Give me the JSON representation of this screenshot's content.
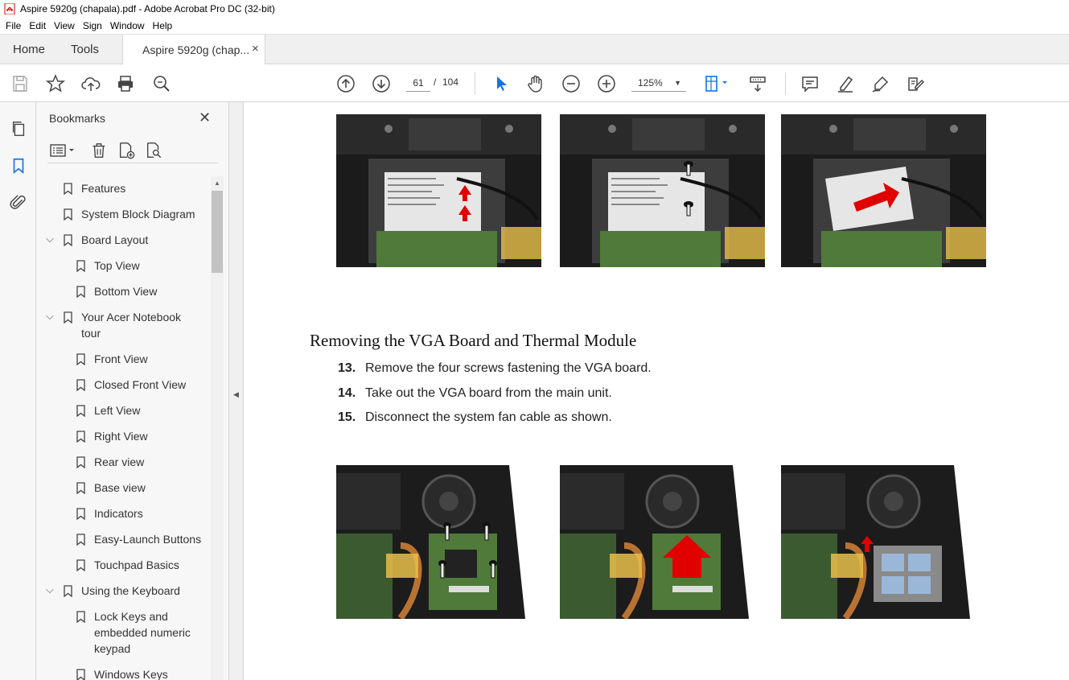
{
  "window": {
    "title": "Aspire 5920g (chapala).pdf - Adobe Acrobat Pro DC (32-bit)"
  },
  "menu": [
    "File",
    "Edit",
    "View",
    "Sign",
    "Window",
    "Help"
  ],
  "tabs": {
    "home": "Home",
    "tools": "Tools",
    "document": "Aspire 5920g (chap...",
    "close_glyph": "×"
  },
  "toolbar": {
    "page_current": "61",
    "page_separator": "/",
    "page_total": "104",
    "zoom": "125%",
    "icons": [
      "save-icon",
      "bookmark-star-icon",
      "upload-icon",
      "print-icon",
      "find-icon",
      "previous-page-icon",
      "next-page-icon",
      "select-arrow-icon",
      "hand-icon",
      "zoom-out-icon",
      "zoom-in-icon",
      "page-display-icon",
      "scrolling-mode-icon",
      "comment-icon",
      "highlight-icon",
      "sign-icon",
      "fill-sign-icon"
    ]
  },
  "left_rail": {
    "icons": [
      "pages-thumbnails-icon",
      "bookmarks-icon",
      "attachments-icon"
    ]
  },
  "bookmarks": {
    "header": "Bookmarks",
    "close_glyph": "✕",
    "items": [
      {
        "label": "Features",
        "level": 0,
        "expanded": null
      },
      {
        "label": "System Block Diagram",
        "level": 0,
        "expanded": null
      },
      {
        "label": "Board Layout",
        "level": 0,
        "expanded": true
      },
      {
        "label": "Top View",
        "level": 1,
        "expanded": null
      },
      {
        "label": "Bottom View",
        "level": 1,
        "expanded": null
      },
      {
        "label": "Your Acer Notebook tour",
        "level": 0,
        "expanded": true
      },
      {
        "label": "Front View",
        "level": 1,
        "expanded": null
      },
      {
        "label": "Closed Front View",
        "level": 1,
        "expanded": null
      },
      {
        "label": "Left View",
        "level": 1,
        "expanded": null
      },
      {
        "label": "Right View",
        "level": 1,
        "expanded": null
      },
      {
        "label": "Rear view",
        "level": 1,
        "expanded": null
      },
      {
        "label": "Base view",
        "level": 1,
        "expanded": null
      },
      {
        "label": "Indicators",
        "level": 1,
        "expanded": null
      },
      {
        "label": "Easy-Launch Buttons",
        "level": 1,
        "expanded": null
      },
      {
        "label": "Touchpad Basics",
        "level": 1,
        "expanded": null
      },
      {
        "label": "Using the Keyboard",
        "level": 0,
        "expanded": true
      },
      {
        "label": "Lock Keys and embedded numeric keypad",
        "level": 1,
        "expanded": null
      },
      {
        "label": "Windows Keys",
        "level": 1,
        "expanded": null
      }
    ]
  },
  "document": {
    "heading": "Removing the VGA Board and Thermal Module",
    "steps": [
      {
        "num": "13.",
        "text": "Remove the four screws fastening the VGA board."
      },
      {
        "num": "14.",
        "text": " Take out the VGA board from the main unit."
      },
      {
        "num": "15.",
        "text": "Disconnect the system fan cable as shown."
      }
    ]
  },
  "colors": {
    "accent_blue": "#1473e6",
    "arrow_red": "#e00000",
    "pcb_green": "#4f7a3a"
  }
}
